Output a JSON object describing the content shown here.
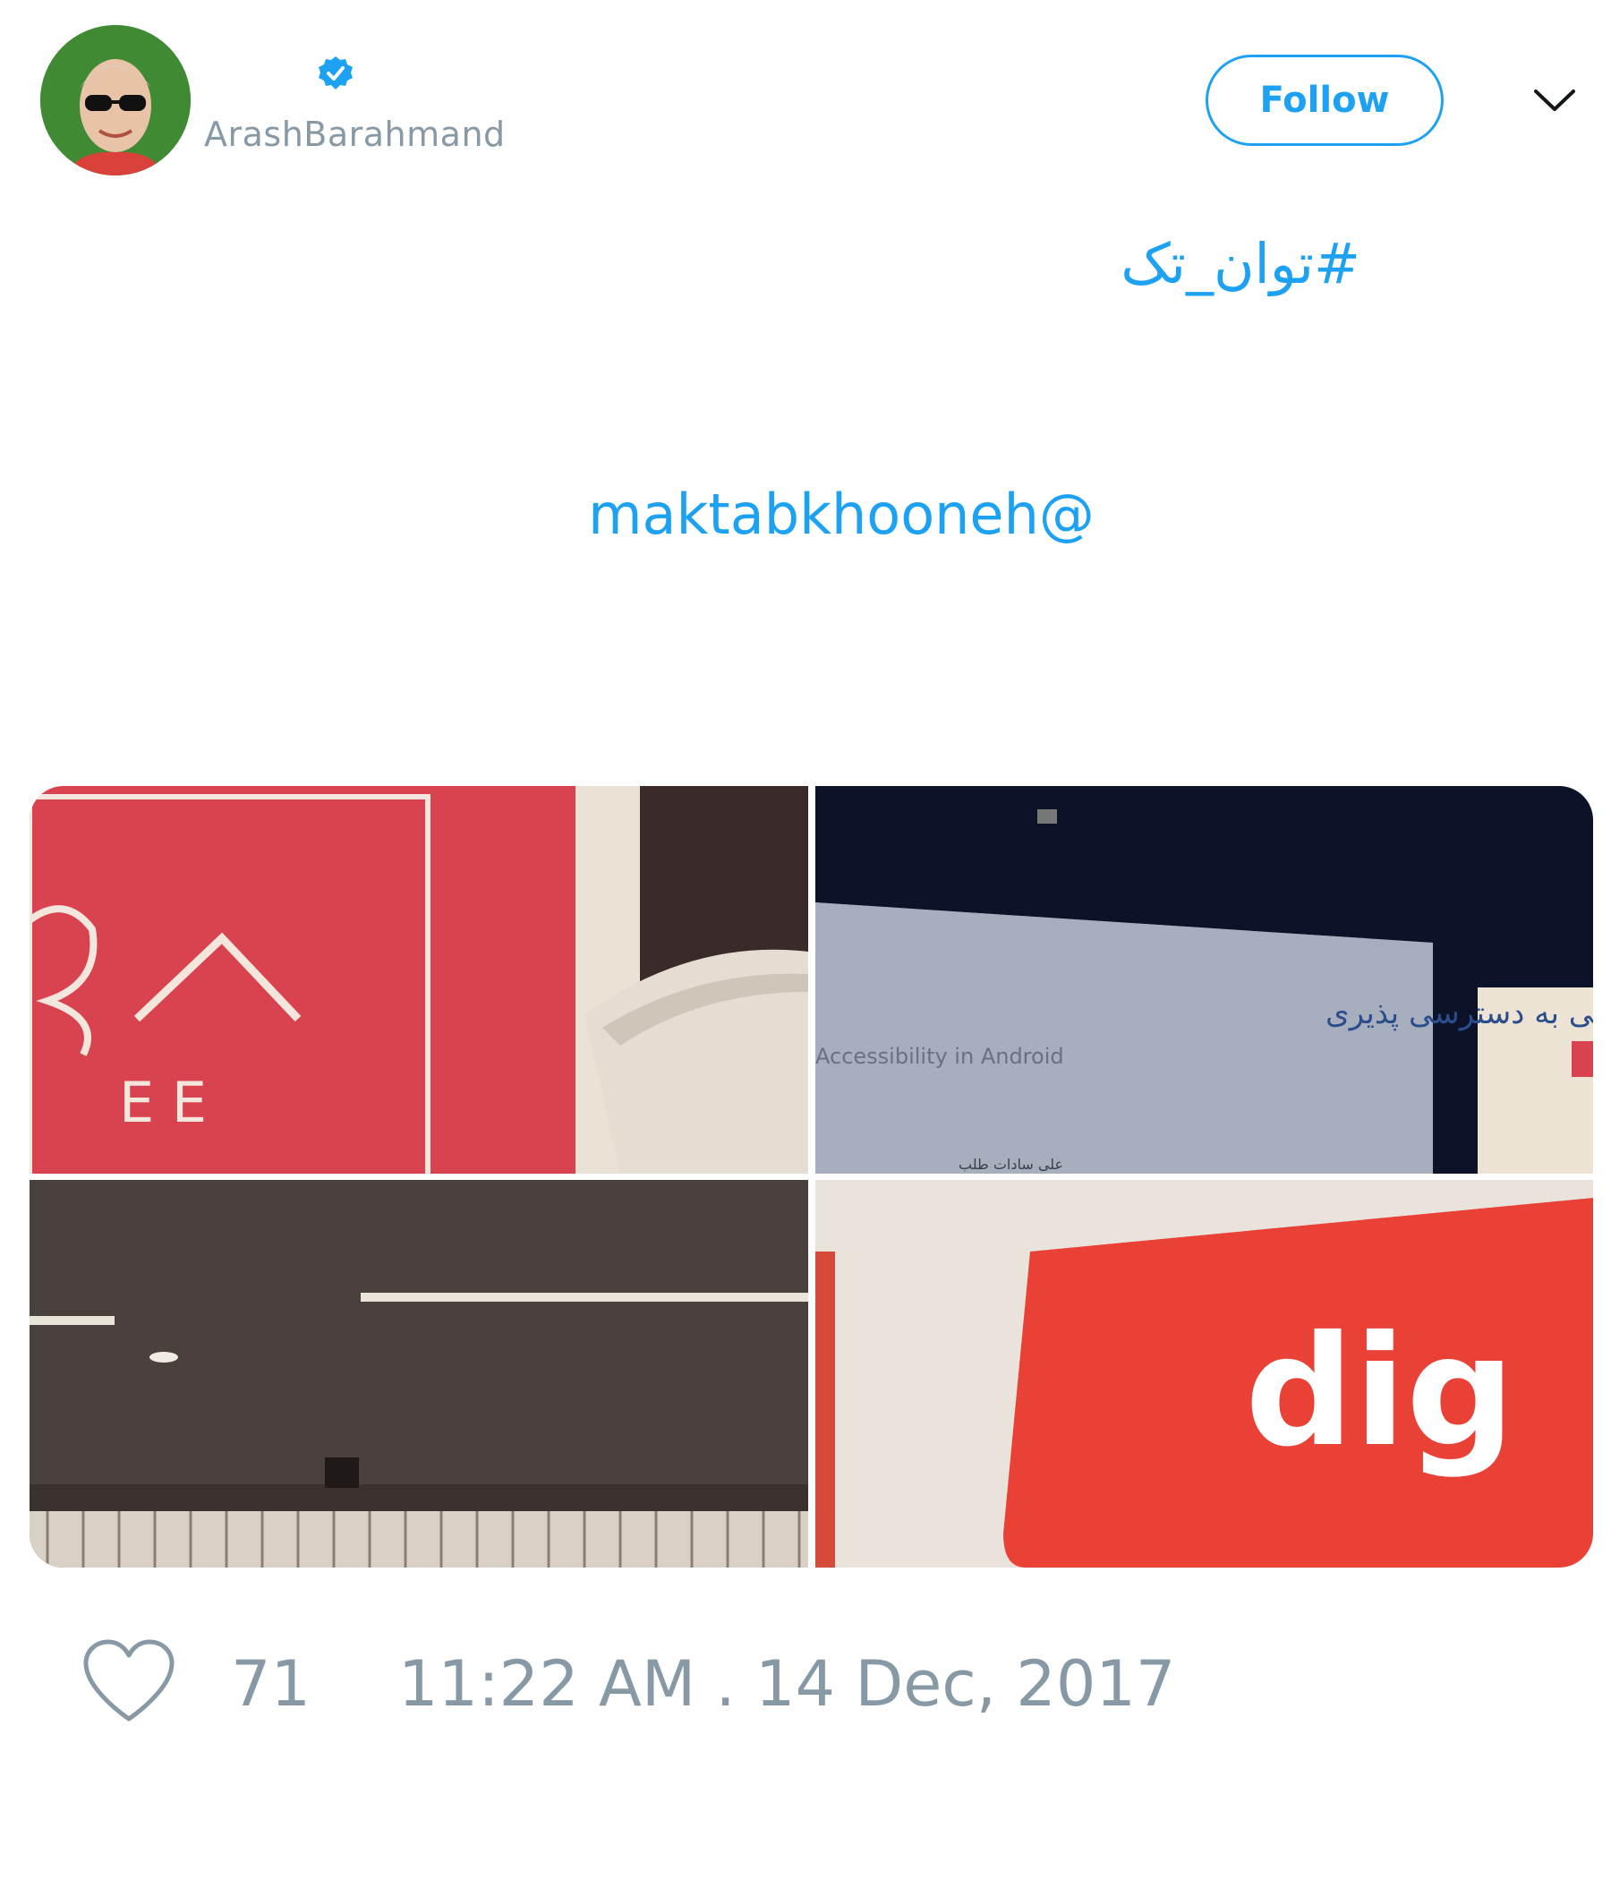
{
  "header": {
    "display_name": "",
    "username": "ArashBarahmand",
    "follow_label": "Follow"
  },
  "tweet": {
    "hashtag": "#توان_تک",
    "mention": "maktabkhooneh@"
  },
  "media": {
    "tile1_text": "E E",
    "tile2_line1": "نگاهی به دسترسی پذیری",
    "tile2_line2": "Accessibility in Android",
    "tile2_line3": "علی سادات طلب",
    "tile4_text": "dig"
  },
  "footer": {
    "likes": "71",
    "timestamp": "11:22 AM . 14 Dec, 2017"
  },
  "colors": {
    "accent": "#1da1f2",
    "muted": "#8899a6"
  }
}
